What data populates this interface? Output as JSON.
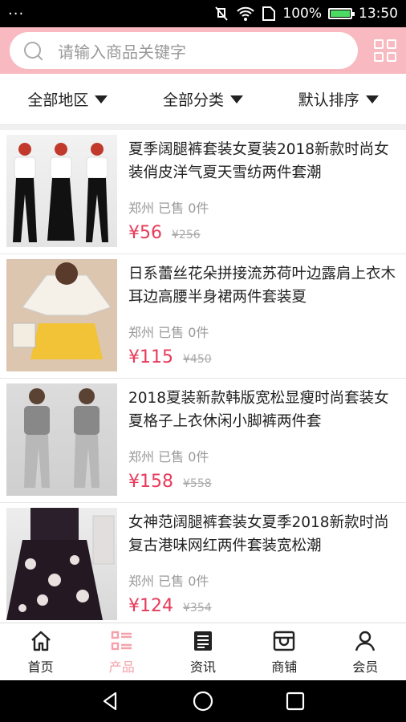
{
  "status": {
    "dots": "···",
    "battery": "100%",
    "time": "13:50"
  },
  "search": {
    "placeholder": "请输入商品关键字"
  },
  "filters": [
    {
      "label": "全部地区"
    },
    {
      "label": "全部分类"
    },
    {
      "label": "默认排序"
    }
  ],
  "products": [
    {
      "title": "夏季阔腿裤套装女夏装2018新款时尚女装俏皮洋气夏天雪纺两件套潮",
      "location": "郑州",
      "sold": "已售 0件",
      "price": "¥56",
      "original": "¥256"
    },
    {
      "title": "日系蕾丝花朵拼接流苏荷叶边露肩上衣木耳边高腰半身裙两件套装夏",
      "location": "郑州",
      "sold": "已售 0件",
      "price": "¥115",
      "original": "¥450"
    },
    {
      "title": "2018夏装新款韩版宽松显瘦时尚套装女夏格子上衣休闲小脚裤两件套",
      "location": "郑州",
      "sold": "已售 0件",
      "price": "¥158",
      "original": "¥558"
    },
    {
      "title": "女神范阔腿裤套装女夏季2018新款时尚复古港味网红两件套装宽松潮",
      "location": "郑州",
      "sold": "已售 0件",
      "price": "¥124",
      "original": "¥354"
    }
  ],
  "tabs": [
    {
      "label": "首页",
      "icon": "home-icon"
    },
    {
      "label": "产品",
      "icon": "list-icon",
      "active": true
    },
    {
      "label": "资讯",
      "icon": "news-icon"
    },
    {
      "label": "商铺",
      "icon": "shop-icon"
    },
    {
      "label": "会员",
      "icon": "user-icon"
    }
  ],
  "colors": {
    "header": "#f8b9c0",
    "accent": "#e83a5a",
    "active_tab": "#f4a1ab"
  }
}
